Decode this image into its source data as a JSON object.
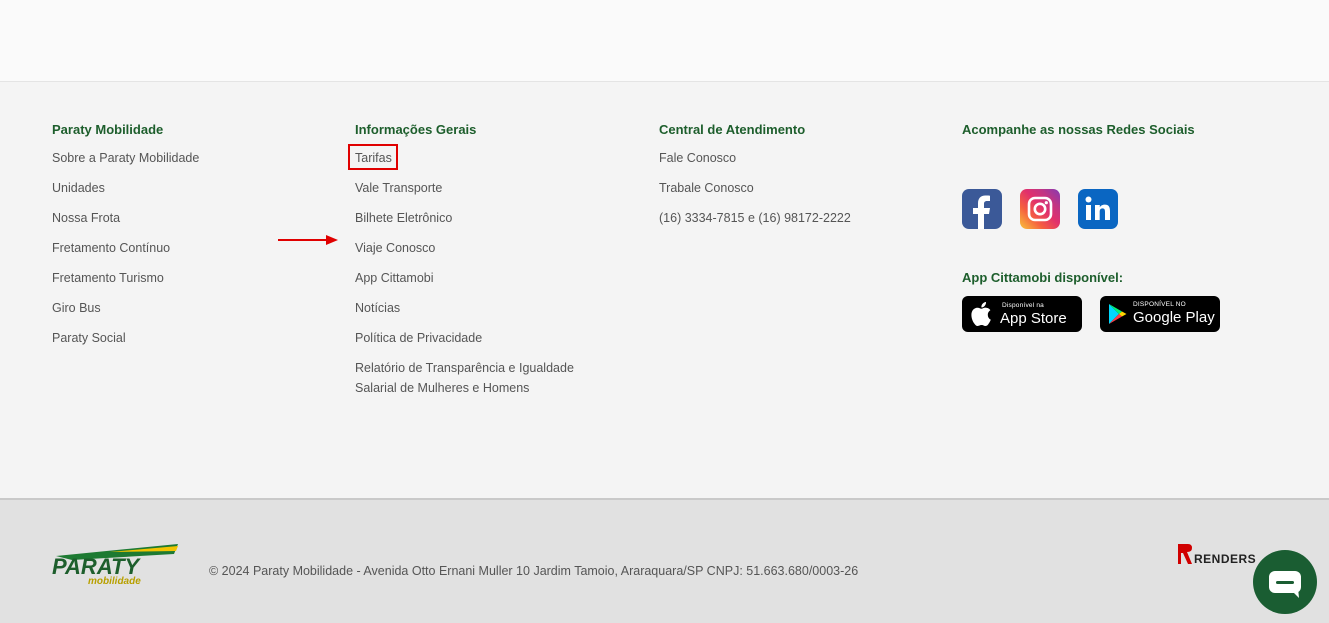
{
  "columns": {
    "paraty": {
      "title": "Paraty Mobilidade",
      "links": [
        "Sobre a Paraty Mobilidade",
        "Unidades",
        "Nossa Frota",
        "Fretamento Contínuo",
        "Fretamento Turismo",
        "Giro Bus",
        "Paraty Social"
      ]
    },
    "info": {
      "title": "Informações Gerais",
      "links": [
        "Tarifas",
        "Vale Transporte",
        "Bilhete Eletrônico",
        "Viaje Conosco",
        "App Cittamobi",
        "Notícias",
        "Política de Privacidade",
        "Relatório de Transparência e Igualdade",
        "Salarial de Mulheres e Homens"
      ]
    },
    "central": {
      "title": "Central de Atendimento",
      "links": [
        "Fale Conosco",
        "Trabale Conosco",
        "(16) 3334-7815 e (16) 98172-2222"
      ]
    },
    "social": {
      "title": "Acompanhe as nossas Redes Sociais",
      "icons": [
        "facebook-icon",
        "instagram-icon",
        "linkedin-icon"
      ],
      "app_title": "App Cittamobi disponível:",
      "appstore": {
        "small": "Disponível na",
        "big": "App Store"
      },
      "googleplay": {
        "small": "DISPONÍVEL NO",
        "big": "Google Play"
      }
    }
  },
  "bottom": {
    "logo_text": "PARATY",
    "logo_sub": "mobilidade",
    "copyright": "© 2024 Paraty Mobilidade - Avenida Otto Ernani Muller 10 Jardim Tamoio, Araraquara/SP CNPJ: 51.663.680/0003-26",
    "renders_logo": "RENDERS"
  },
  "colors": {
    "heading_green": "#1d5e2c",
    "highlight_red": "#e00000",
    "chat_green": "#1a5d32"
  }
}
